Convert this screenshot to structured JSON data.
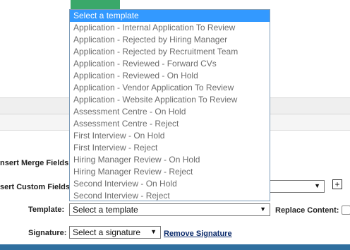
{
  "form": {
    "insert_merge_fields_label": "nsert Merge Fields:",
    "insert_custom_fields_label": "sert Custom Fields:",
    "template_label": "Template:",
    "template_value": "Select a template",
    "replace_content_label": "Replace Content:",
    "signature_label": "Signature:",
    "signature_value": "Select a signature",
    "remove_signature_link": "Remove Signature",
    "custom_fields_plus": "+"
  },
  "dropdown": {
    "options": [
      "Select a template",
      "Application - Internal Application To Review",
      "Application - Rejected by Hiring Manager",
      "Application - Rejected by Recruitment Team",
      "Application - Reviewed - Forward CVs",
      "Application - Reviewed - On Hold",
      "Application - Vendor Application To Review",
      "Application - Website Application To Review",
      "Assessment Centre - On Hold",
      "Assessment Centre - Reject",
      "First Interview - On Hold",
      "First Interview - Reject",
      "Hiring Manager Review - On Hold",
      "Hiring Manager Review - Reject",
      "Second Interview - On Hold",
      "Second Interview - Reject"
    ],
    "selected_index": 0
  }
}
